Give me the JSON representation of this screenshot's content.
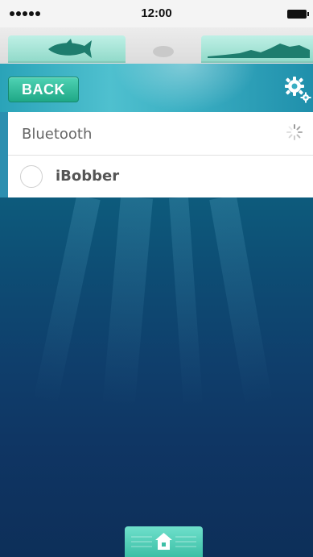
{
  "status_bar": {
    "time": "12:00",
    "signal_icon": "signal-dots-icon",
    "battery_icon": "battery-icon"
  },
  "tabs": [
    {
      "icon": "fish-icon"
    },
    {
      "icon": "bobber-icon"
    },
    {
      "icon": "depth-profile-icon"
    }
  ],
  "header": {
    "back_label": "BACK",
    "settings_icon": "gear-icon"
  },
  "bluetooth": {
    "label": "Bluetooth",
    "status_icon": "loading-spinner-icon",
    "devices": [
      {
        "name": "iBobber",
        "selected": false
      }
    ]
  },
  "footer": {
    "home_icon": "home-icon"
  },
  "colors": {
    "accent": "#3cbfa6",
    "header": "#3aaec2",
    "ocean_top": "#0d5b7c",
    "ocean_bottom": "#0d2f59"
  }
}
